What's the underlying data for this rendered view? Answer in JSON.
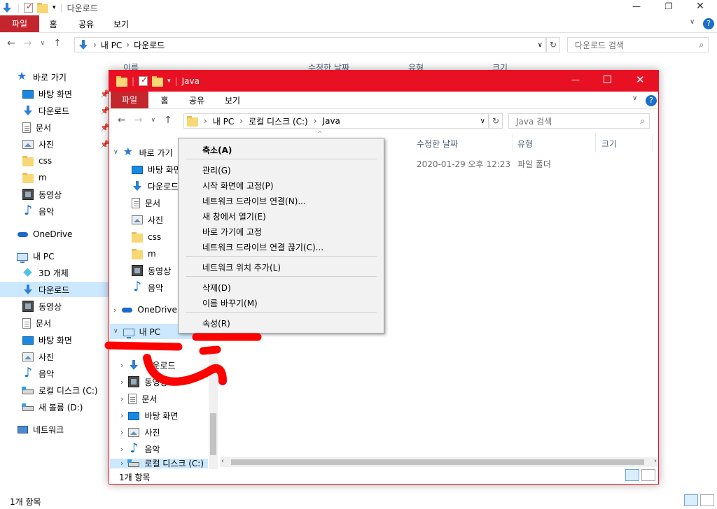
{
  "outer": {
    "title": "다운로드",
    "tabs": [
      "파일",
      "홈",
      "공유",
      "보기"
    ],
    "path": [
      "내 PC",
      "다운로드"
    ],
    "search_placeholder": "다운로드 검색",
    "columns": [
      "이름",
      "수정한 날짜",
      "유형",
      "크기"
    ],
    "nav": {
      "quick_access": "바로 가기",
      "quick_items": [
        "바탕 화면",
        "다운로드",
        "문서",
        "사진",
        "css",
        "m",
        "동영상",
        "음악"
      ],
      "onedrive": "OneDrive",
      "this_pc": "내 PC",
      "pc_items": [
        "3D 개체",
        "다운로드",
        "동영상",
        "문서",
        "바탕 화면",
        "사진",
        "음악",
        "로컬 디스크 (C:)",
        "새 볼륨 (D:)"
      ],
      "network": "네트워크"
    },
    "status": "1개 항목"
  },
  "inner": {
    "title": "Java",
    "tabs": [
      "파일",
      "홈",
      "공유",
      "보기"
    ],
    "path": [
      "내 PC",
      "로컬 디스크 (C:)",
      "Java"
    ],
    "search_placeholder": "Java 검색",
    "columns": [
      "수정한 날짜",
      "유형",
      "크기"
    ],
    "row": {
      "date": "2020-01-29 오후 12:23",
      "type": "파일 폴더"
    },
    "nav": {
      "quick_access": "바로 가기",
      "quick_items": [
        "바탕 화면",
        "다운로드",
        "문서",
        "사진",
        "css",
        "m",
        "동영상",
        "음악"
      ],
      "onedrive": "OneDrive",
      "this_pc": "내 PC",
      "pc_items": [
        "다운로드",
        "동영상",
        "문서",
        "바탕 화면",
        "사진",
        "음악",
        "로컬 디스크 (C:)"
      ]
    },
    "status": "1개 항목",
    "accent": "#e81123"
  },
  "context_menu": {
    "items": [
      {
        "label": "축소(A)",
        "bold": true
      },
      {
        "label": "관리(G)"
      },
      {
        "label": "시작 화면에 고정(P)"
      },
      {
        "label": "네트워크 드라이브 연결(N)..."
      },
      {
        "label": "새 창에서 열기(E)"
      },
      {
        "label": "바로 가기에 고정"
      },
      {
        "label": "네트워크 드라이브 연결 끊기(C)..."
      },
      {
        "label": "네트워크 위치 추가(L)"
      },
      {
        "label": "삭제(D)"
      },
      {
        "label": "이름 바꾸기(M)"
      },
      {
        "label": "속성(R)"
      }
    ]
  },
  "annotation_color": "#ff0000"
}
